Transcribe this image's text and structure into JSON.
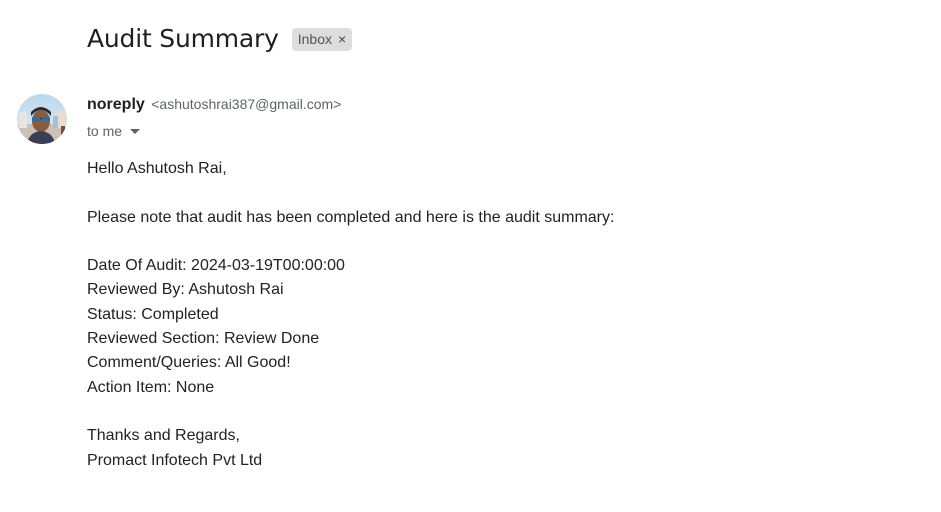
{
  "email": {
    "subject": "Audit Summary",
    "label": "Inbox",
    "label_remove": "×",
    "sender_name": "noreply",
    "sender_email": "<ashutoshrai387@gmail.com>",
    "recipient": "to me",
    "greeting": "Hello Ashutosh Rai,",
    "intro": "Please note that audit has been completed and here is the audit summary:",
    "details": [
      "Date Of Audit: 2024-03-19T00:00:00",
      "Reviewed By: Ashutosh Rai",
      "Status: Completed",
      "Reviewed Section: Review Done",
      "Comment/Queries: All Good!",
      "Action Item: None"
    ],
    "closing": "Thanks and Regards,",
    "company": "Promact Infotech Pvt Ltd"
  },
  "icons": {
    "avatar": "avatar-photo",
    "remove_label": "close-icon",
    "details_toggle": "caret-down-icon"
  },
  "colors": {
    "label_chip_bg": "#dddddd",
    "text_primary": "#222222",
    "text_secondary": "#5f6368"
  }
}
